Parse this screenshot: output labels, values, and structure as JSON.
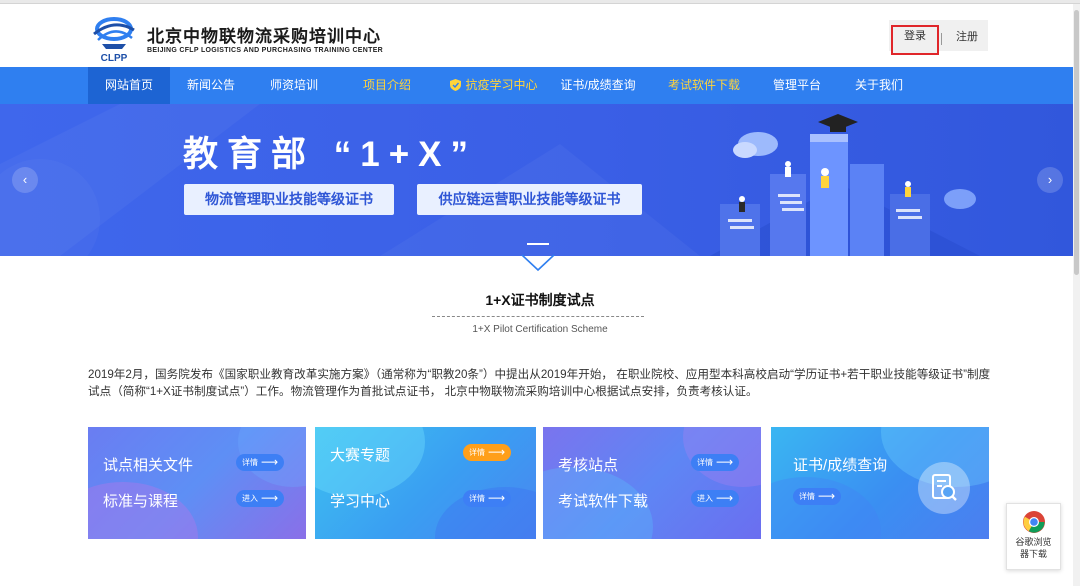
{
  "header": {
    "logo_mark_text": "CLPP",
    "title_cn": "北京中物联物流采购培训中心",
    "title_en": "BEIJING CFLP LOGISTICS AND PURCHASING TRAINING CENTER",
    "login_label": "登录",
    "register_label": "注册"
  },
  "nav": {
    "items": [
      {
        "label": "网站首页",
        "active": true
      },
      {
        "label": "新闻公告"
      },
      {
        "label": "师资培训"
      },
      {
        "label": "项目介绍",
        "highlight": true
      },
      {
        "label": "抗疫学习中心",
        "highlight": true,
        "icon": "shield-icon"
      },
      {
        "label": "证书/成绩查询"
      },
      {
        "label": "考试软件下载",
        "highlight": true
      },
      {
        "label": "管理平台"
      },
      {
        "label": "关于我们"
      }
    ]
  },
  "banner": {
    "headline": "教育部 “1+X”",
    "cert1": "物流管理职业技能等级证书",
    "cert2": "供应链运营职业技能等级证书",
    "prev_icon": "chevron-left-icon",
    "next_icon": "chevron-right-icon",
    "prev_glyph": "‹",
    "next_glyph": "›"
  },
  "section": {
    "title": "1+X证书制度试点",
    "subtitle": "1+X Pilot Certification Scheme",
    "intro": "2019年2月，国务院发布《国家职业教育改革实施方案》（通常称为“职教20条”）中提出从2019年开始， 在职业院校、应用型本科高校启动“学历证书+若干职业技能等级证书”制度试点（简称“1+X证书制度试点”）工作。物流管理作为首批试点证书， 北京中物联物流采购培训中心根据试点安排，负责考核认证。"
  },
  "cards": {
    "c1": {
      "label1": "试点相关文件",
      "btn1": "详情",
      "label2": "标准与课程",
      "btn2": "进入"
    },
    "c2": {
      "label1": "大赛专题",
      "btn1": "详情",
      "label2": "学习中心",
      "btn2": "详情"
    },
    "c3": {
      "label1": "考核站点",
      "btn1": "详情",
      "label2": "考试软件下载",
      "btn2": "进入"
    },
    "c4": {
      "label1": "证书/成绩查询",
      "btn1": "详情",
      "icon": "search-document-icon"
    }
  },
  "arrow_glyph": "⟶",
  "chrome_widget": {
    "line1": "谷歌浏览",
    "line2": "器下载",
    "icon": "chrome-icon"
  },
  "colors": {
    "nav_blue": "#2f7ff0",
    "nav_active": "#1d64d3",
    "highlight_gold": "#ffd43b",
    "login_border": "#e0262a",
    "banner_blue": "#3f67ec",
    "orange_button": "#ff9f1a"
  }
}
